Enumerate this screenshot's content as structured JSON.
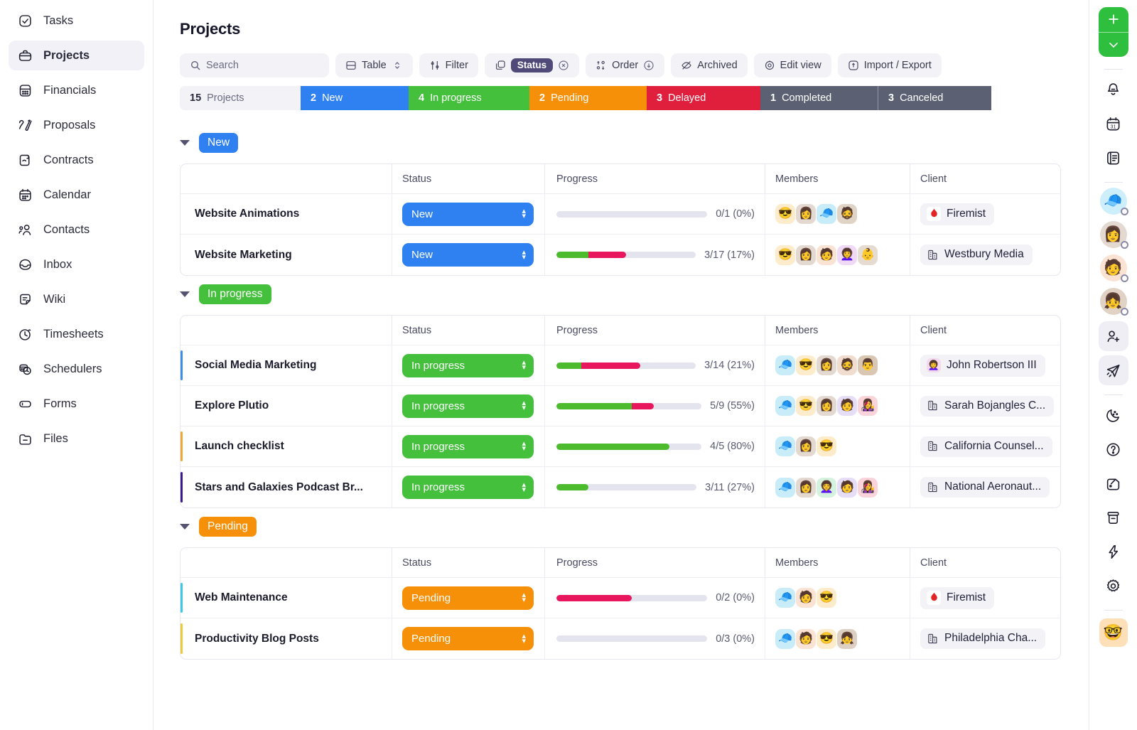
{
  "sidebar": {
    "items": [
      {
        "label": "Tasks",
        "icon": "check-square-icon",
        "active": false
      },
      {
        "label": "Projects",
        "icon": "briefcase-icon",
        "active": true
      },
      {
        "label": "Financials",
        "icon": "calculator-icon",
        "active": false
      },
      {
        "label": "Proposals",
        "icon": "pen-icon",
        "active": false
      },
      {
        "label": "Contracts",
        "icon": "scroll-icon",
        "active": false
      },
      {
        "label": "Calendar",
        "icon": "calendar-icon",
        "active": false
      },
      {
        "label": "Contacts",
        "icon": "people-icon",
        "active": false
      },
      {
        "label": "Inbox",
        "icon": "inbox-icon",
        "active": false
      },
      {
        "label": "Wiki",
        "icon": "note-icon",
        "active": false
      },
      {
        "label": "Timesheets",
        "icon": "clock-icon",
        "active": false
      },
      {
        "label": "Schedulers",
        "icon": "scheduler-icon",
        "active": false
      },
      {
        "label": "Forms",
        "icon": "form-icon",
        "active": false
      },
      {
        "label": "Files",
        "icon": "folder-icon",
        "active": false
      }
    ]
  },
  "header": {
    "title": "Projects"
  },
  "toolbar": {
    "search_placeholder": "Search",
    "table_label": "Table",
    "filter_label": "Filter",
    "status_chip_label": "Status",
    "order_label": "Order",
    "archived_label": "Archived",
    "edit_view_label": "Edit view",
    "import_export_label": "Import / Export"
  },
  "status_strip": {
    "total_count": "15",
    "total_label": "Projects",
    "segments": [
      {
        "count": "2",
        "label": "New",
        "color": "#2f80f0"
      },
      {
        "count": "4",
        "label": "In progress",
        "color": "#44c03c"
      },
      {
        "count": "2",
        "label": "Pending",
        "color": "#f79009"
      },
      {
        "count": "3",
        "label": "Delayed",
        "color": "#e01f3d"
      },
      {
        "count": "1",
        "label": "Completed",
        "color": "#5b6172"
      },
      {
        "count": "3",
        "label": "Canceled",
        "color": "#5b6172"
      }
    ]
  },
  "table_columns": [
    "",
    "Status",
    "Progress",
    "Members",
    "Client"
  ],
  "groups": [
    {
      "name": "New",
      "badge_color": "#2f80f0",
      "rows": [
        {
          "name": "Website Animations",
          "accent": "transparent",
          "status": "New",
          "status_color": "#2f80f0",
          "progress_text": "0/1 (0%)",
          "green_pct": 0,
          "pink_pct": 0,
          "members": [
            {
              "emoji": "😎",
              "bg": "#fdeccb"
            },
            {
              "emoji": "👩",
              "bg": "#e3d9d0"
            },
            {
              "emoji": "🧢",
              "bg": "#c8ecf8"
            },
            {
              "emoji": "🧔",
              "bg": "#e0d4c6"
            }
          ],
          "client": "Firemist",
          "client_icon": "firemist-logo"
        },
        {
          "name": "Website Marketing",
          "accent": "transparent",
          "status": "New",
          "status_color": "#2f80f0",
          "progress_text": "3/17 (17%)",
          "green_pct": 23,
          "pink_pct": 27,
          "members": [
            {
              "emoji": "😎",
              "bg": "#fdeccb"
            },
            {
              "emoji": "👩",
              "bg": "#e3d9d0"
            },
            {
              "emoji": "🧑",
              "bg": "#fbe3d4"
            },
            {
              "emoji": "👩‍🦱",
              "bg": "#f0d9f7"
            },
            {
              "emoji": "👶",
              "bg": "#e6dbd0"
            }
          ],
          "client": "Westbury Media",
          "client_icon": "building-icon"
        }
      ]
    },
    {
      "name": "In progress",
      "badge_color": "#44c03c",
      "rows": [
        {
          "name": "Social Media Marketing",
          "accent": "#3d8ee8",
          "status": "In progress",
          "status_color": "#44c03c",
          "progress_text": "3/14 (21%)",
          "green_pct": 18,
          "pink_pct": 42,
          "members": [
            {
              "emoji": "🧢",
              "bg": "#c8ecf8"
            },
            {
              "emoji": "😎",
              "bg": "#fdeccb"
            },
            {
              "emoji": "👩",
              "bg": "#e3d9d0"
            },
            {
              "emoji": "🧔",
              "bg": "#f0ddd0"
            },
            {
              "emoji": "👨",
              "bg": "#d9c6b3"
            }
          ],
          "client": "John Robertson III",
          "client_icon": "avatar",
          "client_avatar": "👩‍🦱",
          "client_avatar_bg": "#f4d9ef"
        },
        {
          "name": "Explore Plutio",
          "accent": "transparent",
          "status": "In progress",
          "status_color": "#44c03c",
          "progress_text": "5/9 (55%)",
          "green_pct": 52,
          "pink_pct": 15,
          "members": [
            {
              "emoji": "🧢",
              "bg": "#c8ecf8"
            },
            {
              "emoji": "😎",
              "bg": "#fdeccb"
            },
            {
              "emoji": "👩",
              "bg": "#e3d9d0"
            },
            {
              "emoji": "🧑",
              "bg": "#e6ddf7"
            },
            {
              "emoji": "👩‍🎤",
              "bg": "#fbd3db"
            }
          ],
          "client": "Sarah Bojangles C...",
          "client_icon": "building-icon"
        },
        {
          "name": "Launch checklist",
          "accent": "#f0a73a",
          "status": "In progress",
          "status_color": "#44c03c",
          "progress_text": "4/5 (80%)",
          "green_pct": 78,
          "pink_pct": 0,
          "members": [
            {
              "emoji": "🧢",
              "bg": "#c8ecf8"
            },
            {
              "emoji": "👩",
              "bg": "#e3d9d0"
            },
            {
              "emoji": "😎",
              "bg": "#fdeccb"
            }
          ],
          "client": "California Counsel...",
          "client_icon": "building-icon"
        },
        {
          "name": "Stars and Galaxies Podcast Br...",
          "accent": "#3d1a8c",
          "status": "In progress",
          "status_color": "#44c03c",
          "progress_text": "3/11 (27%)",
          "green_pct": 23,
          "pink_pct": 0,
          "members": [
            {
              "emoji": "🧢",
              "bg": "#c8ecf8"
            },
            {
              "emoji": "👩",
              "bg": "#e3d9d0"
            },
            {
              "emoji": "👩‍🦱",
              "bg": "#d5f2de"
            },
            {
              "emoji": "🧑",
              "bg": "#e6ddf7"
            },
            {
              "emoji": "👩‍🎤",
              "bg": "#fbd3db"
            }
          ],
          "client": "National Aeronaut...",
          "client_icon": "building-icon"
        }
      ]
    },
    {
      "name": "Pending",
      "badge_color": "#f79009",
      "rows": [
        {
          "name": "Web Maintenance",
          "accent": "#3ec8e8",
          "status": "Pending",
          "status_color": "#f79009",
          "progress_text": "0/2 (0%)",
          "green_pct": 0,
          "pink_pct": 50,
          "members": [
            {
              "emoji": "🧢",
              "bg": "#c8ecf8"
            },
            {
              "emoji": "🧑",
              "bg": "#fbe3d4"
            },
            {
              "emoji": "😎",
              "bg": "#fdeccb"
            }
          ],
          "client": "Firemist",
          "client_icon": "firemist-logo"
        },
        {
          "name": "Productivity Blog Posts",
          "accent": "#f0c93a",
          "status": "Pending",
          "status_color": "#f79009",
          "progress_text": "0/3 (0%)",
          "green_pct": 0,
          "pink_pct": 0,
          "members": [
            {
              "emoji": "🧢",
              "bg": "#c8ecf8"
            },
            {
              "emoji": "🧑",
              "bg": "#fbe3d4"
            },
            {
              "emoji": "😎",
              "bg": "#fdeccb"
            },
            {
              "emoji": "👧",
              "bg": "#ddd0c2"
            }
          ],
          "client": "Philadelphia Cha...",
          "client_icon": "building-icon"
        }
      ]
    }
  ],
  "rail": {
    "add_label": "+",
    "icons": [
      {
        "name": "bell-icon"
      },
      {
        "name": "calendar-31-icon"
      },
      {
        "name": "notes-icon"
      }
    ],
    "avatars": [
      {
        "emoji": "🧢",
        "bg": "#cdeefb"
      },
      {
        "emoji": "👩",
        "bg": "#e3d9d0"
      },
      {
        "emoji": "🧑",
        "bg": "#fbe3d4"
      },
      {
        "emoji": "👧",
        "bg": "#e0d3c6"
      }
    ],
    "action_icons": [
      {
        "name": "add-user-icon"
      },
      {
        "name": "send-icon"
      }
    ],
    "bottom_icons": [
      {
        "name": "moon-icon"
      },
      {
        "name": "help-icon"
      },
      {
        "name": "wallet-icon"
      },
      {
        "name": "archive-icon"
      },
      {
        "name": "bolt-icon"
      },
      {
        "name": "gear-icon"
      }
    ],
    "me_avatar": "🤓"
  },
  "colors": {
    "new": "#2f80f0",
    "in_progress": "#44c03c",
    "pending": "#f79009",
    "delayed": "#e01f3d",
    "neutral": "#5b6172",
    "green_bar": "#4cbb2e",
    "pink_bar": "#e8175d"
  }
}
